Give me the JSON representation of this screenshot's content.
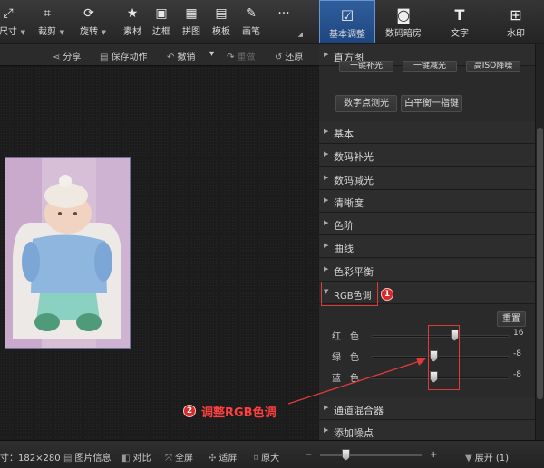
{
  "toolbar": {
    "items": [
      {
        "label": "尺寸",
        "icon": "resize-icon"
      },
      {
        "label": "裁剪",
        "icon": "crop-icon"
      },
      {
        "label": "旋转",
        "icon": "rotate-icon"
      },
      {
        "label": "素材",
        "icon": "sticker-icon"
      },
      {
        "label": "边框",
        "icon": "frame-icon"
      },
      {
        "label": "拼图",
        "icon": "collage-icon"
      },
      {
        "label": "模板",
        "icon": "template-icon"
      },
      {
        "label": "画笔",
        "icon": "brush-icon"
      },
      {
        "label": "···",
        "icon": "more-icon"
      }
    ]
  },
  "tabs": [
    {
      "label": "基本调整",
      "icon": "adjust-icon",
      "active": true
    },
    {
      "label": "数码暗房",
      "icon": "darkroom-icon",
      "active": false
    },
    {
      "label": "文字",
      "icon": "text-icon",
      "active": false
    },
    {
      "label": "水印",
      "icon": "watermark-icon",
      "active": false
    }
  ],
  "actions": {
    "share": "分享",
    "save_action": "保存动作",
    "undo": "撤销",
    "redo": "重做",
    "restore": "还原"
  },
  "panel": {
    "histogram": "直方图",
    "top_buttons_partial": [
      "一键补光",
      "一键减光",
      "高ISO降噪"
    ],
    "buttons": [
      "数字点测光",
      "白平衡一指键"
    ],
    "sections": [
      "基本",
      "数码补光",
      "数码减光",
      "清晰度",
      "色阶",
      "曲线",
      "色彩平衡"
    ],
    "rgb": {
      "title": "RGB色调",
      "reset": "重置",
      "rows": [
        {
          "name": "红色",
          "value": "16",
          "level": 0.6
        },
        {
          "name": "绿色",
          "value": "-8",
          "level": 0.45
        },
        {
          "name": "蓝色",
          "value": "-8",
          "level": 0.45
        }
      ]
    },
    "after_sections": [
      "通道混合器",
      "添加噪点"
    ]
  },
  "status": {
    "size": "寸：182×280",
    "info": "图片信息",
    "compare": "对比",
    "fullscreen": "全屏",
    "fit": "适屏",
    "actual": "原大",
    "minus": "−",
    "plus": "+",
    "expand": "展开 (1)",
    "zoom_level": 0.25
  },
  "annotations": {
    "badge1": "1",
    "badge2": "2",
    "text2": "调整RGB色调"
  }
}
